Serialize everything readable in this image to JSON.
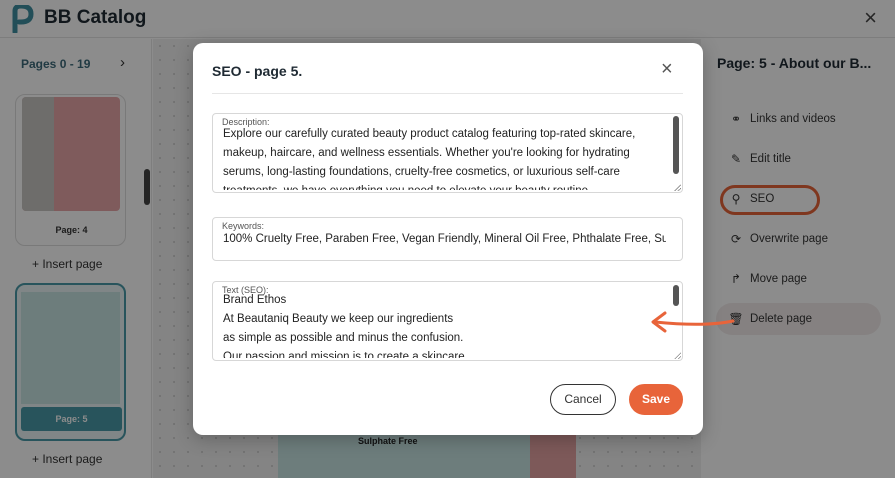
{
  "app": {
    "title": "BB Catalog",
    "close_icon": "×"
  },
  "left_panel": {
    "pages_range": "Pages 0 - 19",
    "next_icon": "›",
    "thumbs": [
      {
        "label": "Page: 4"
      },
      {
        "label": "Page: 5"
      }
    ],
    "insert_page": "+ Insert page"
  },
  "canvas": {
    "visible_text": "Sulphate Free"
  },
  "right_panel": {
    "title": "Page: 5 - About our B...",
    "items": [
      {
        "label": "Links and videos",
        "icon": "link-icon"
      },
      {
        "label": "Edit title",
        "icon": "pencil-icon"
      },
      {
        "label": "SEO",
        "icon": "magnifier-icon"
      },
      {
        "label": "Overwrite page",
        "icon": "refresh-icon"
      },
      {
        "label": "Move page",
        "icon": "move-icon"
      },
      {
        "label": "Delete page",
        "icon": "trash-icon"
      }
    ]
  },
  "modal": {
    "title": "SEO - page 5.",
    "close_icon": "×",
    "description": {
      "label": "Description:",
      "value": "Explore our carefully curated beauty product catalog featuring top-rated skincare, makeup, haircare, and wellness essentials. Whether you're looking for hydrating serums, long-lasting foundations, cruelty-free cosmetics, or luxurious self-care treatments, we have everything you need to elevate your beauty routine."
    },
    "keywords": {
      "label": "Keywords:",
      "value": "100% Cruelty Free, Paraben Free, Vegan Friendly, Mineral Oil Free, Phthalate Free, Sulphate Free"
    },
    "text_seo": {
      "label": "Text (SEO):",
      "value": "Brand Ethos\nAt Beautaniq Beauty we keep our ingredients\nas simple as possible and minus the confusion.\nOur passion and mission is to create a skincare"
    },
    "cancel_label": "Cancel",
    "save_label": "Save"
  },
  "colors": {
    "accent": "#e8643a",
    "teal": "#4a9aa8",
    "overlay": "rgba(0,0,0,0.45)"
  }
}
